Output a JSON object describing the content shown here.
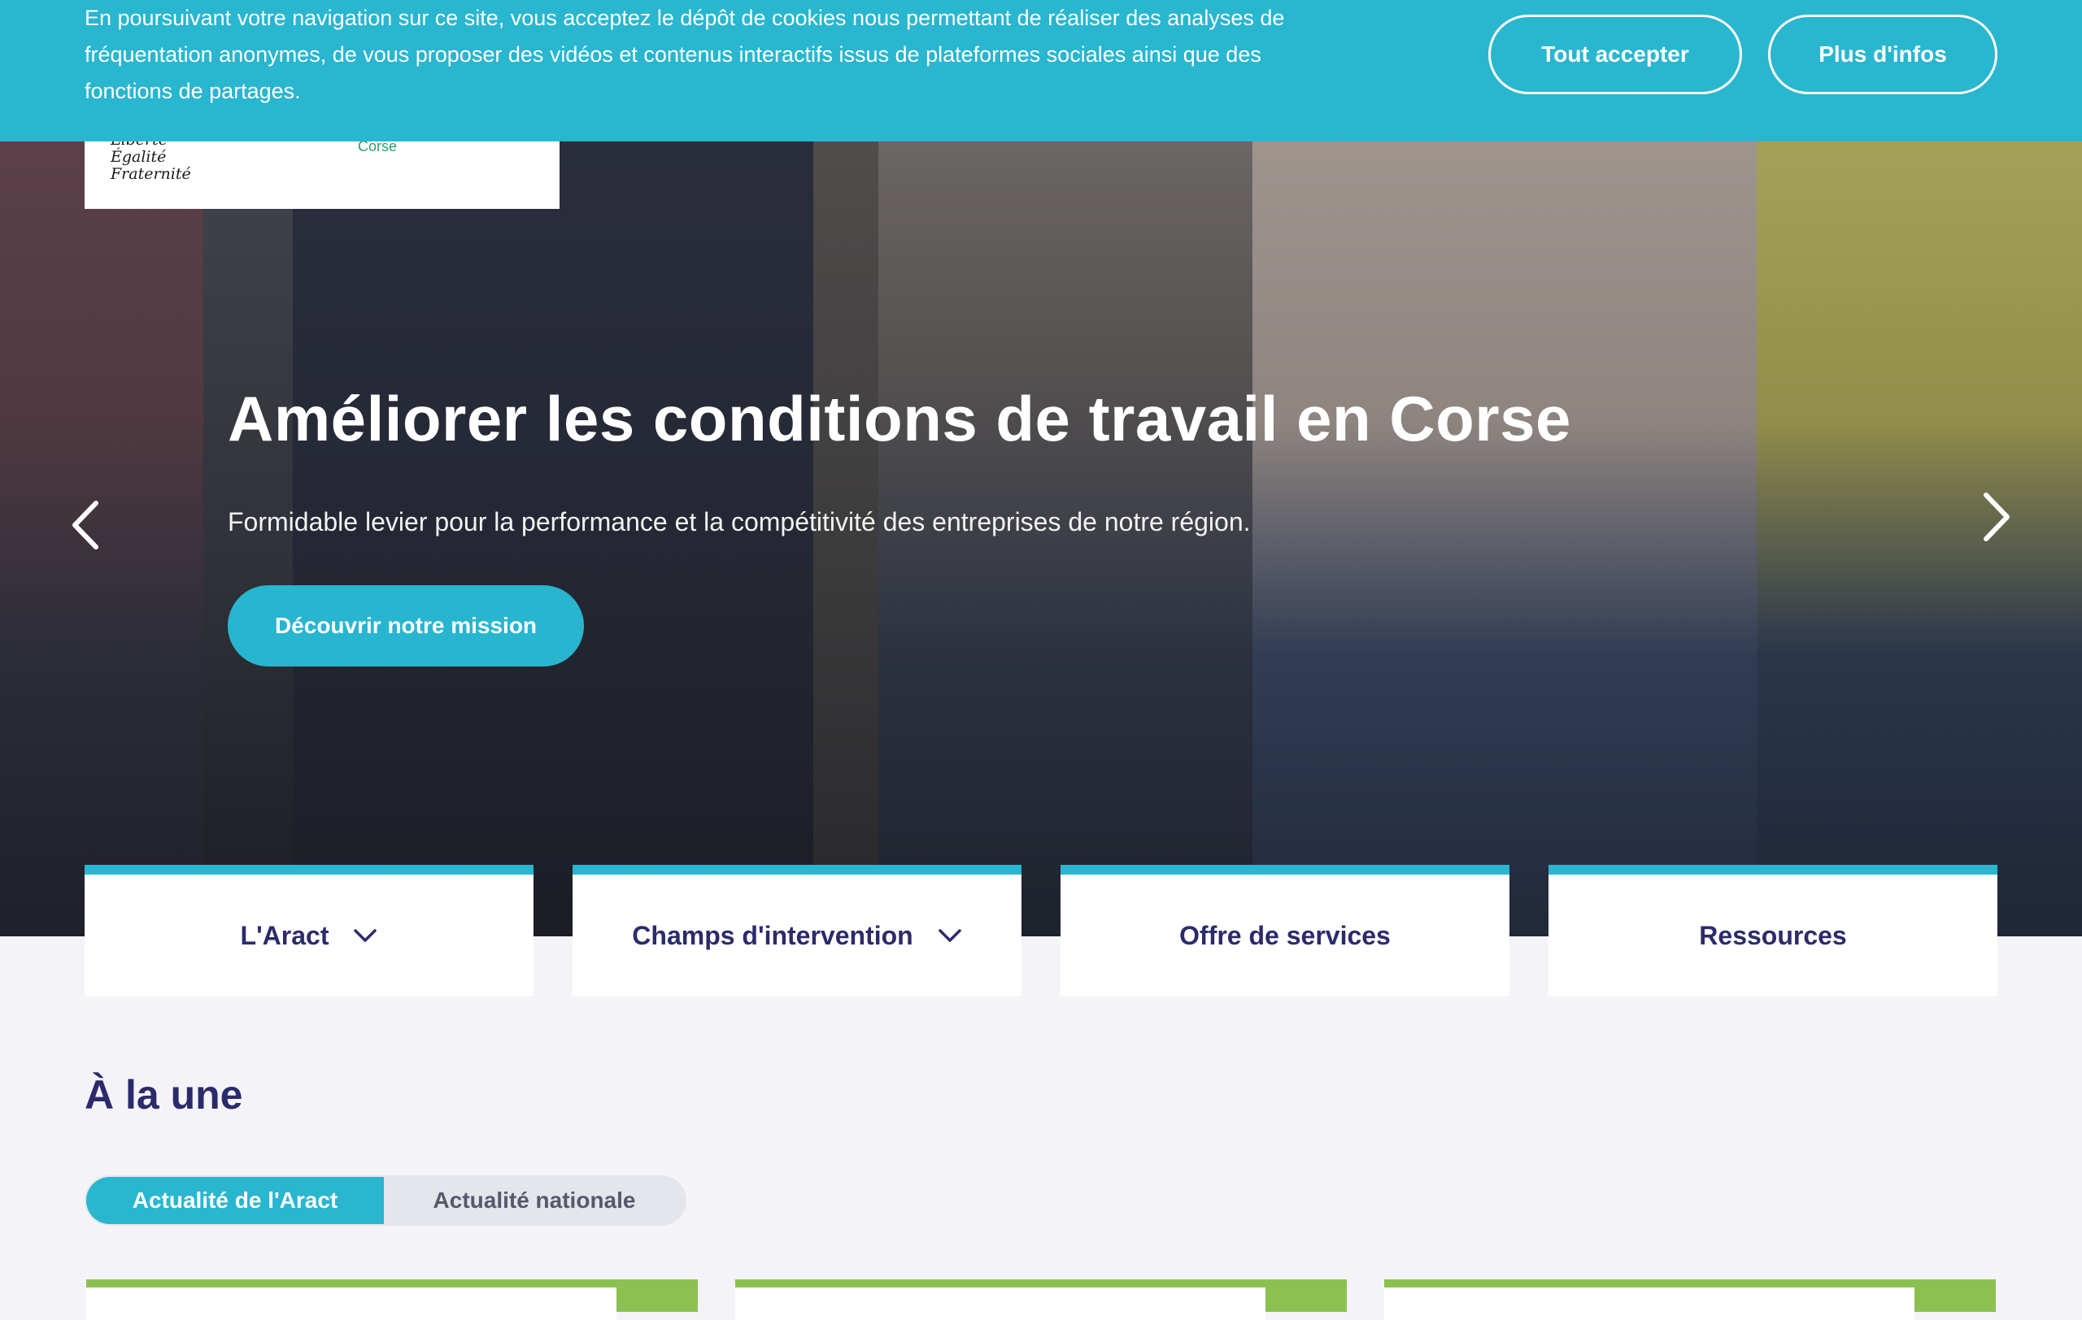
{
  "cookie_banner": {
    "text": "En poursuivant votre navigation sur ce site, vous acceptez le dépôt de cookies nous permettant de réaliser des analyses de fréquentation anonymes, de vous proposer des vidéos et contenus interactifs issus de plateformes sociales ainsi que des fonctions de partages.",
    "accept_label": "Tout accepter",
    "info_label": "Plus d'infos"
  },
  "logo": {
    "motto": [
      "Liberté",
      "Égalité",
      "Fraternité"
    ],
    "region": "Corse"
  },
  "hero": {
    "title": "Améliorer les conditions de travail en Corse",
    "subtitle": "Formidable levier pour la performance et la compétitivité des entreprises de notre région.",
    "cta_label": "Découvrir notre mission",
    "prev_icon": "chevron-left-icon",
    "next_icon": "chevron-right-icon"
  },
  "nav": {
    "items": [
      {
        "label": "L'Aract",
        "has_dropdown": true
      },
      {
        "label": "Champs d'intervention",
        "has_dropdown": true
      },
      {
        "label": "Offre de services",
        "has_dropdown": false
      },
      {
        "label": "Ressources",
        "has_dropdown": false
      }
    ]
  },
  "news": {
    "title": "À la une",
    "tabs": [
      {
        "label": "Actualité de l'Aract",
        "active": true
      },
      {
        "label": "Actualité nationale",
        "active": false
      }
    ]
  },
  "colors": {
    "accent": "#29b6cf",
    "navy": "#2b2b6b",
    "green": "#8cc152",
    "background": "#f4f4f8"
  }
}
